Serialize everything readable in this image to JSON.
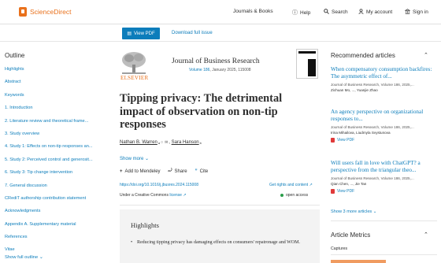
{
  "header": {
    "brand": "ScienceDirect",
    "nav": [
      {
        "label": "Journals & Books",
        "icon": ""
      },
      {
        "label": "Help",
        "icon": "help-circle-icon"
      },
      {
        "label": "Search",
        "icon": "search-icon"
      },
      {
        "label": "My account",
        "icon": "user-icon"
      },
      {
        "label": "Sign in",
        "icon": "institution-icon"
      }
    ]
  },
  "toolbar": {
    "view_pdf": "View PDF",
    "download_full_issue": "Download full issue"
  },
  "outline": {
    "heading": "Outline",
    "items": [
      "Highlights",
      "Abstract",
      "Keywords",
      "1. Introduction",
      "2. Literature review and theoretical frame...",
      "3. Study overview",
      "4. Study 1: Effects on non-tip responses an...",
      "5. Study 2: Perceived control and generosit...",
      "6. Study 3: Tip change intervention",
      "7. General discussion",
      "CRediT authorship contribution statement",
      "Acknowledgments",
      "Appendix A. Supplementary material",
      "References",
      "Vitae"
    ],
    "show_full": "Show full outline"
  },
  "article": {
    "publisher": "ELSEVIER",
    "journal": "Journal of Business Research",
    "volume": "Volume 186",
    "issue_info": ", January 2025, 115008",
    "title": "Tipping privacy: The detrimental impact of observation on non-tip responses",
    "authors": [
      {
        "name": "Nathan B. Warren",
        "sup": "a"
      },
      {
        "name": "Sara Hanson",
        "sup": "b"
      }
    ],
    "show_more": "Show more",
    "actions": {
      "add_mendeley": "Add to Mendeley",
      "share": "Share",
      "cite": "Cite"
    },
    "doi": "https://doi.org/10.1016/j.jbusres.2024.115008",
    "rights": "Get rights and content",
    "license_prefix": "Under a Creative Commons",
    "license_link": "license",
    "open_access": "open access",
    "highlights_heading": "Highlights",
    "highlights": [
      "Reducing tipping privacy has damaging effects on consumers' repatronage and WOM."
    ]
  },
  "sidebar": {
    "recommended_heading": "Recommended articles",
    "recommended": [
      {
        "title": "When compensatory consumption backfires: The asymmetric effect of...",
        "source": "Journal of Business Research, Volume 186, 2025,...",
        "authors": "Zichuan Mo, ..., Yuanjie Zhao",
        "has_pdf": false
      },
      {
        "title": "An agency perspective on organizational responses to...",
        "source": "Journal of Business Research, Volume 186, 2025,...",
        "authors": "Irina Mihailova, Liudmyla Svystunova",
        "has_pdf": true,
        "pdf_label": "View PDF"
      },
      {
        "title": "Will users fall in love with ChatGPT? a perspective from the triangular theo...",
        "source": "Journal of Business Research, Volume 186, 2025,...",
        "authors": "Qian Chen, ..., Jie Tan",
        "has_pdf": true,
        "pdf_label": "View PDF"
      }
    ],
    "show_more": "Show 3 more articles",
    "metrics_heading": "Article Metrics",
    "captures_label": "Captures"
  },
  "colors": {
    "brand_orange": "#e9711c",
    "link_blue": "#0c7dbb",
    "open_access_green": "#2a9d4a",
    "pdf_red": "#e03a3a"
  }
}
